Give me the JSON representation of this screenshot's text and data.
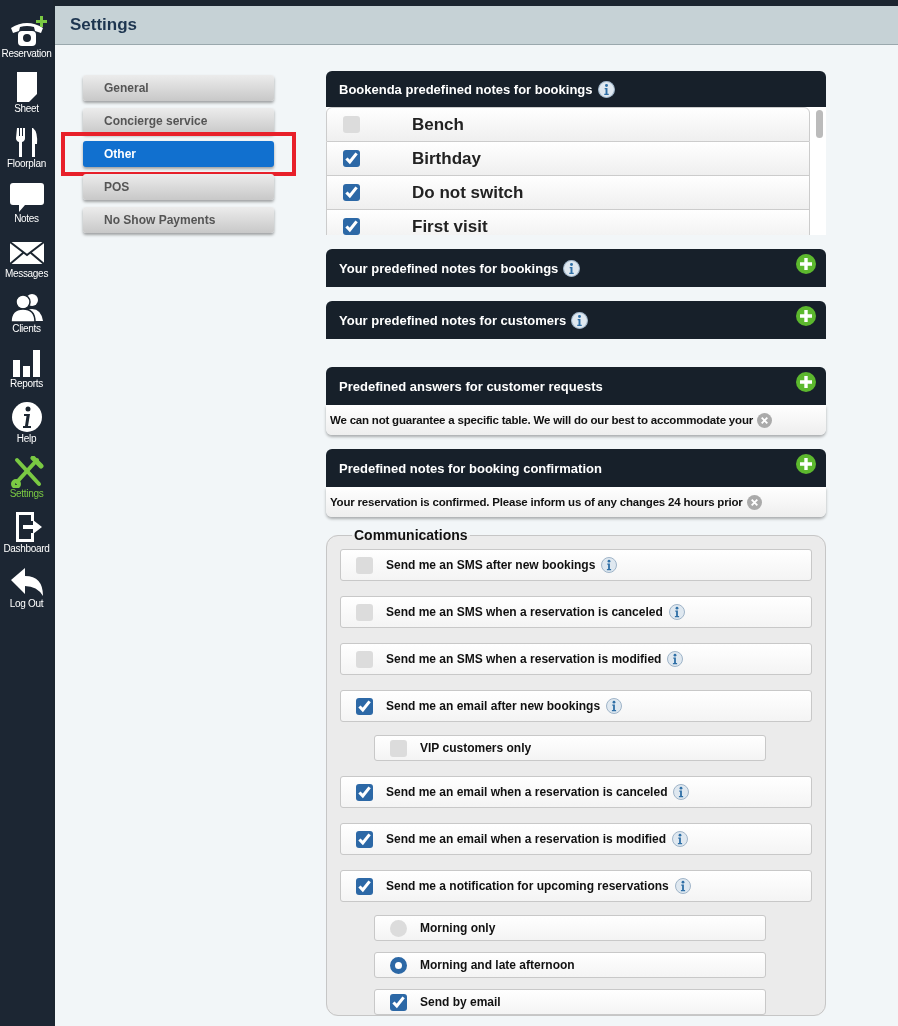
{
  "app_nav": [
    {
      "label": "Reservation",
      "selected": false
    },
    {
      "label": "Sheet",
      "selected": false
    },
    {
      "label": "Floorplan",
      "selected": false
    },
    {
      "label": "Notes",
      "selected": false
    },
    {
      "label": "Messages",
      "selected": false
    },
    {
      "label": "Clients",
      "selected": false
    },
    {
      "label": "Reports",
      "selected": false
    },
    {
      "label": "Help",
      "selected": false
    },
    {
      "label": "Settings",
      "selected": true
    },
    {
      "label": "Dashboard",
      "selected": false
    },
    {
      "label": "Log Out",
      "selected": false
    }
  ],
  "header": {
    "title": "Settings"
  },
  "settings_menu": [
    {
      "label": "General",
      "selected": false,
      "highlighted": false
    },
    {
      "label": "Concierge service",
      "selected": false,
      "highlighted": false
    },
    {
      "label": "Other",
      "selected": true,
      "highlighted": true
    },
    {
      "label": "POS",
      "selected": false,
      "highlighted": false
    },
    {
      "label": "No Show Payments",
      "selected": false,
      "highlighted": false
    }
  ],
  "bookenda_notes": {
    "title": "Bookenda predefined notes for bookings",
    "info": true,
    "items": [
      {
        "label": "Bench",
        "checked": false
      },
      {
        "label": "Birthday",
        "checked": true
      },
      {
        "label": "Do not switch",
        "checked": true
      },
      {
        "label": "First visit",
        "checked": true
      }
    ]
  },
  "sections": [
    {
      "title": "Your predefined notes for bookings",
      "info": true,
      "add": true
    },
    {
      "title": "Your predefined notes for customers",
      "info": true,
      "add": true
    },
    {
      "title": "Predefined answers for customer requests",
      "add": true,
      "entries": [
        {
          "text": "We can not guarantee a specific table. We will do our best to accommodate your"
        }
      ]
    },
    {
      "title": "Predefined notes for booking confirmation",
      "add": true,
      "entries": [
        {
          "text": "Your reservation is confirmed. Please inform us of any changes 24 hours prior"
        }
      ]
    }
  ],
  "communications": {
    "title": "Communications",
    "options": [
      {
        "kind": "checkbox",
        "label": "Send me an SMS after new bookings",
        "checked": false,
        "info": true
      },
      {
        "kind": "checkbox",
        "label": "Send me an SMS when a reservation is canceled",
        "checked": false,
        "info": true
      },
      {
        "kind": "checkbox",
        "label": "Send me an SMS when a reservation is modified",
        "checked": false,
        "info": true
      },
      {
        "kind": "checkbox",
        "label": "Send me an email after new bookings",
        "checked": true,
        "info": true,
        "children": [
          {
            "kind": "checkbox",
            "label": "VIP customers only",
            "checked": false
          }
        ]
      },
      {
        "kind": "checkbox",
        "label": "Send me an email when a reservation is canceled",
        "checked": true,
        "info": true
      },
      {
        "kind": "checkbox",
        "label": "Send me an email when a reservation is modified",
        "checked": true,
        "info": true
      },
      {
        "kind": "checkbox",
        "label": "Send me a notification for upcoming reservations",
        "checked": true,
        "info": true,
        "children": [
          {
            "kind": "radio",
            "label": "Morning only",
            "checked": false
          },
          {
            "kind": "radio",
            "label": "Morning and late afternoon",
            "checked": true
          },
          {
            "kind": "checkbox",
            "label": "Send by email",
            "checked": true
          }
        ]
      }
    ]
  }
}
